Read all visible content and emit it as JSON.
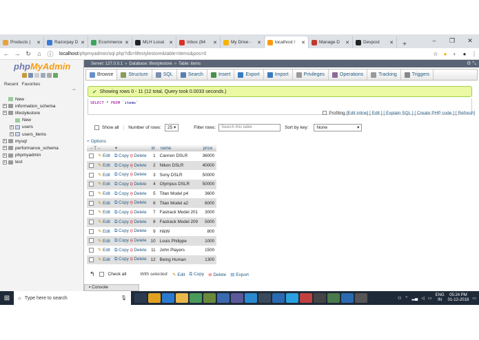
{
  "browser": {
    "tabs": [
      {
        "title": "Products |",
        "color": "#e8a33b"
      },
      {
        "title": "Razorpay D",
        "color": "#3a7bd5"
      },
      {
        "title": "Ecommerce",
        "color": "#3ca55c"
      },
      {
        "title": "MLH Local",
        "color": "#222222"
      },
      {
        "title": "Inbox (84",
        "color": "#d93025"
      },
      {
        "title": "My Drive -",
        "color": "#f4b400"
      },
      {
        "title": "localhost /",
        "color": "#f89c0e"
      },
      {
        "title": "Manage D",
        "color": "#c0392b"
      },
      {
        "title": "Devpost",
        "color": "#222222"
      }
    ],
    "active_tab": 6,
    "url_host": "localhost",
    "url_path": "/phpmyadmin/sql.php?db=lifestylestore&table=items&pos=0"
  },
  "sidebar": {
    "logo_php": "php",
    "logo_myadmin": "MyAdmin",
    "tab_recent": "Recent",
    "tab_favorites": "Favorites",
    "tree": [
      {
        "label": "New",
        "level": 0,
        "kind": "new"
      },
      {
        "label": "information_schema",
        "level": 0,
        "kind": "db"
      },
      {
        "label": "lifestylestore",
        "level": 0,
        "kind": "db"
      },
      {
        "label": "New",
        "level": 1,
        "kind": "new"
      },
      {
        "label": "users",
        "level": 1,
        "kind": "tbl"
      },
      {
        "label": "users_items",
        "level": 1,
        "kind": "tbl"
      },
      {
        "label": "mysql",
        "level": 0,
        "kind": "db"
      },
      {
        "label": "performance_schema",
        "level": 0,
        "kind": "db"
      },
      {
        "label": "phpmyadmin",
        "level": 0,
        "kind": "db"
      },
      {
        "label": "test",
        "level": 0,
        "kind": "db"
      }
    ]
  },
  "breadcrumb": {
    "server": "Server: 127.0.0.1",
    "database": "Database: lifestylestore",
    "table": "Table: items"
  },
  "menu": [
    {
      "label": "Browse",
      "icon": "browse-icon",
      "color": "#6a8fc7"
    },
    {
      "label": "Structure",
      "icon": "structure-icon",
      "color": "#8a9a5b"
    },
    {
      "label": "SQL",
      "icon": "sql-icon",
      "color": "#7a8fb0"
    },
    {
      "label": "Search",
      "icon": "search-icon",
      "color": "#5b7db0"
    },
    {
      "label": "Insert",
      "icon": "insert-icon",
      "color": "#4a8f4a"
    },
    {
      "label": "Export",
      "icon": "export-icon",
      "color": "#3a7bc0"
    },
    {
      "label": "Import",
      "icon": "import-icon",
      "color": "#3a7bc0"
    },
    {
      "label": "Privileges",
      "icon": "privileges-icon",
      "color": "#999999"
    },
    {
      "label": "Operations",
      "icon": "operations-icon",
      "color": "#8a6a9a"
    },
    {
      "label": "Tracking",
      "icon": "tracking-icon",
      "color": "#999999"
    },
    {
      "label": "Triggers",
      "icon": "triggers-icon",
      "color": "#888888"
    }
  ],
  "result": {
    "message": "Showing rows 0 - 11 (12 total, Query took 0.0033 seconds.)",
    "sql_kw1": "SELECT",
    "sql_star": "*",
    "sql_kw2": "FROM",
    "sql_table": "`items`"
  },
  "profiling": {
    "label": "Profiling",
    "links": "[Edit inline] [ Edit ] [ Explain SQL ] [ Create PHP code ] [ Refresh]"
  },
  "controls": {
    "show_all": "Show all",
    "num_rows_label": "Number of rows:",
    "num_rows_value": "25",
    "filter_label": "Filter rows:",
    "filter_placeholder": "Search this table",
    "sort_label": "Sort by key:",
    "sort_value": "None",
    "options_link": "+ Options"
  },
  "table": {
    "headers": [
      "id",
      "name",
      "price"
    ],
    "actions": {
      "edit": "Edit",
      "copy": "Copy",
      "delete": "Delete"
    },
    "rows": [
      {
        "id": "1",
        "name": "Cannon DSLR",
        "price": "36000"
      },
      {
        "id": "2",
        "name": "Nikon DSLR",
        "price": "40000"
      },
      {
        "id": "3",
        "name": "Sony DSLR",
        "price": "50000"
      },
      {
        "id": "4",
        "name": "Olympus DSLR",
        "price": "50000"
      },
      {
        "id": "5",
        "name": "Titan Model p4",
        "price": "3600"
      },
      {
        "id": "6",
        "name": "Titan Model a2",
        "price": "6000"
      },
      {
        "id": "7",
        "name": "Fastrack Model 201",
        "price": "3000"
      },
      {
        "id": "8",
        "name": "Fastrack Model 209",
        "price": "5000"
      },
      {
        "id": "9",
        "name": "H&W",
        "price": "800"
      },
      {
        "id": "10",
        "name": "Louis Philippe",
        "price": "1000"
      },
      {
        "id": "11",
        "name": "John Players",
        "price": "1500"
      },
      {
        "id": "12",
        "name": "Being Human",
        "price": "1300"
      }
    ]
  },
  "bottom": {
    "check_all": "Check all",
    "with_selected": "With selected:",
    "edit": "Edit",
    "copy": "Copy",
    "delete": "Delete",
    "export": "Export"
  },
  "console_label": "Console",
  "taskbar": {
    "search_placeholder": "Type here to search",
    "lang": "ENG",
    "region": "IN",
    "time": "05:24 PM",
    "date": "01-12-2018"
  }
}
